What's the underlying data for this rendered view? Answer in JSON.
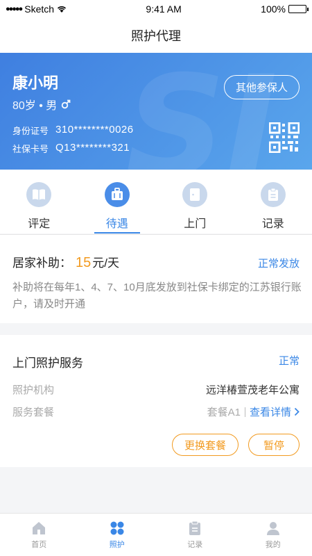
{
  "status_bar": {
    "carrier": "Sketch",
    "time": "9:41 AM",
    "battery": "100%"
  },
  "nav": {
    "title": "照护代理"
  },
  "profile": {
    "name": "康小明",
    "meta": "80岁 • 男",
    "other_insured": "其他参保人",
    "id_label": "身份证号",
    "id_value": "310********0026",
    "card_label": "社保卡号",
    "card_value": "Q13********321"
  },
  "tabs": [
    {
      "label": "评定",
      "icon": "book-icon"
    },
    {
      "label": "待遇",
      "icon": "briefcase-icon"
    },
    {
      "label": "上门",
      "icon": "door-icon"
    },
    {
      "label": "记录",
      "icon": "clipboard-icon"
    }
  ],
  "subsidy": {
    "label": "居家补助：",
    "amount": "15",
    "unit": "元/天",
    "status": "正常发放",
    "description": "补助将在每年1、4、7、10月底发放到社保卡绑定的江苏银行账户，请及时开通"
  },
  "service": {
    "title": "上门照护服务",
    "status": "正常",
    "org_label": "照护机构",
    "org_value": "远洋椿萱茂老年公寓",
    "package_label": "服务套餐",
    "package_value": "套餐A1",
    "details_link": "查看详情",
    "change_button": "更换套餐",
    "pause_button": "暂停"
  },
  "tabbar": [
    {
      "label": "首页",
      "icon": "home-icon"
    },
    {
      "label": "照护",
      "icon": "care-icon"
    },
    {
      "label": "记录",
      "icon": "record-icon"
    },
    {
      "label": "我的",
      "icon": "user-icon"
    }
  ],
  "colors": {
    "accent": "#3a87e6",
    "orange": "#f29a1f",
    "card_gradient_start": "#3f7fe0",
    "card_gradient_end": "#5aa6ec"
  }
}
